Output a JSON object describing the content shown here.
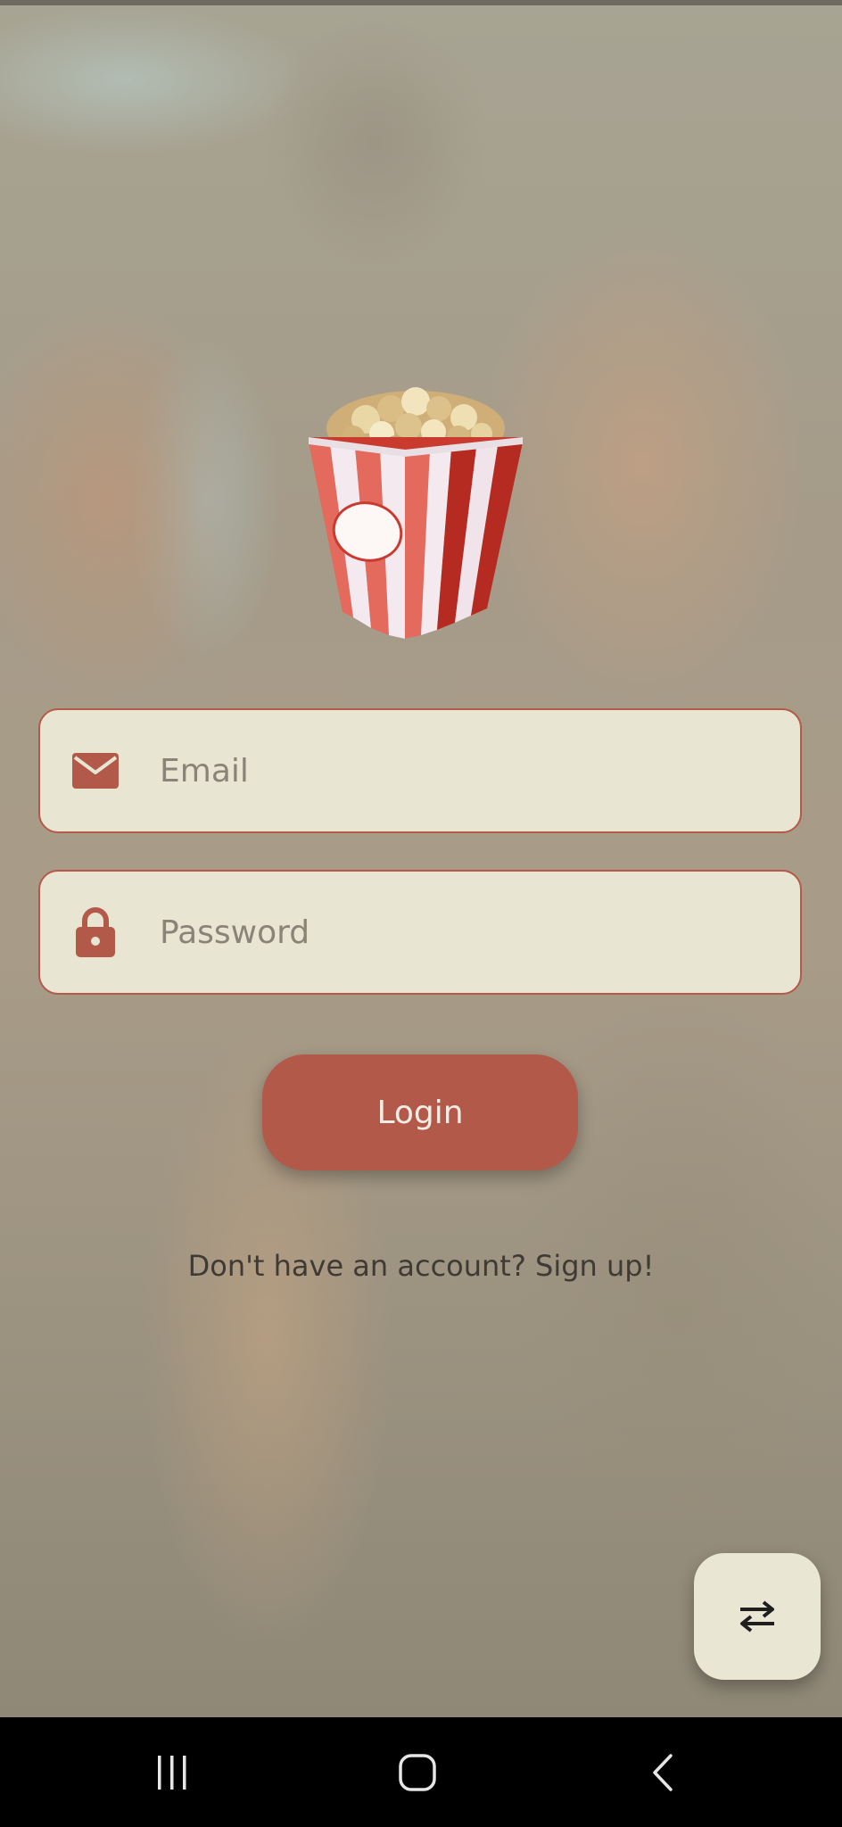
{
  "app": {
    "logo": "popcorn-bucket-logo"
  },
  "login_form": {
    "email": {
      "placeholder": "Email",
      "value": "",
      "icon": "envelope-icon"
    },
    "password": {
      "placeholder": "Password",
      "value": "",
      "icon": "lock-icon"
    },
    "login_label": "Login",
    "signup_prompt": "Don't have an account? Sign up!"
  },
  "fab": {
    "icon": "swap-arrows-icon"
  },
  "system_nav": {
    "recents_icon": "recents-icon",
    "home_icon": "home-icon",
    "back_icon": "back-icon"
  },
  "colors": {
    "accent": "#b3594a",
    "field_background": "#e8e6d3",
    "field_border": "#b5594a",
    "button_text": "#f3ece4",
    "nav_background": "#000000"
  }
}
